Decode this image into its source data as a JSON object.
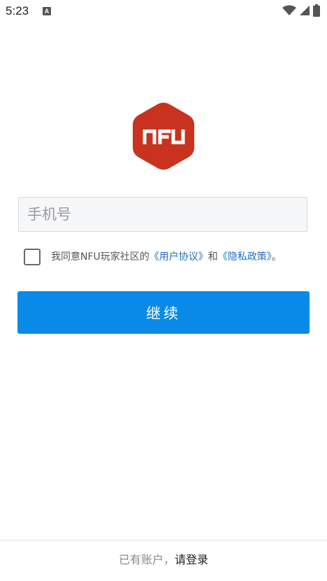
{
  "status_bar": {
    "time": "5:23",
    "notification_badge": "A"
  },
  "logo": {
    "text": "NFU",
    "color": "#c8321e"
  },
  "phone": {
    "placeholder": "手机号"
  },
  "agreement": {
    "prefix": "我同意NFU玩家社区的",
    "user_agreement": "《用户协议》",
    "and": "和",
    "privacy_policy": "《隐私政策》",
    "suffix": "。"
  },
  "continue_button": {
    "label": "继续"
  },
  "footer": {
    "prefix": "已有账户，",
    "login_link": "请登录"
  },
  "colors": {
    "primary": "#0a8ae8",
    "link": "#1f6fc5",
    "logo": "#c8321e"
  }
}
